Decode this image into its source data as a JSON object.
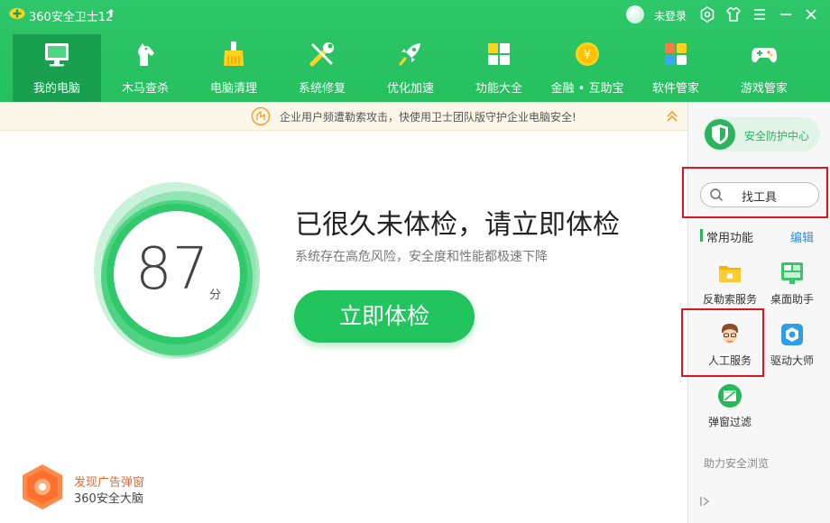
{
  "titlebar": {
    "app_title": "360安全卫士12",
    "login_label": "未登录"
  },
  "nav": {
    "items": [
      {
        "label": "我的电脑",
        "icon": "monitor-icon",
        "active": true
      },
      {
        "label": "木马查杀",
        "icon": "horse-icon",
        "active": false
      },
      {
        "label": "电脑清理",
        "icon": "broom-icon",
        "active": false
      },
      {
        "label": "系统修复",
        "icon": "wrench-icon",
        "active": false
      },
      {
        "label": "优化加速",
        "icon": "rocket-icon",
        "active": false
      },
      {
        "label": "功能大全",
        "icon": "apps-grid-icon",
        "active": false
      },
      {
        "label": "金融 • 互助宝",
        "icon": "yen-coin-icon",
        "active": false
      },
      {
        "label": "软件管家",
        "icon": "software-store-icon",
        "active": false
      },
      {
        "label": "游戏管家",
        "icon": "gamepad-icon",
        "active": false
      }
    ]
  },
  "notice": {
    "text": "企业用户频遭勒索攻击，快使用卫士团队版守护企业电脑安全!"
  },
  "main": {
    "score": "87",
    "score_unit": "分",
    "headline": "已很久未体检，请立即体检",
    "subline": "系统存在高危风险，安全度和性能都极速下降",
    "check_button": "立即体检"
  },
  "brain": {
    "title": "发现广告弹窗",
    "subtitle": "360安全大脑"
  },
  "sidebar": {
    "security_center": "安全防护中心",
    "search_label": "找工具",
    "common_title": "常用功能",
    "edit_label": "编辑",
    "tools": [
      {
        "label": "反勒索服务",
        "icon": "folder-lock-icon"
      },
      {
        "label": "桌面助手",
        "icon": "desktop-assistant-icon"
      },
      {
        "label": "人工服务",
        "icon": "support-person-icon"
      },
      {
        "label": "驱动大师",
        "icon": "driver-icon"
      },
      {
        "label": "弹窗过滤",
        "icon": "popup-filter-icon"
      }
    ],
    "more_label": "助力安全浏览"
  },
  "colors": {
    "brand_green": "#25c05e",
    "active_nav": "#19a04f",
    "highlight_red": "#e0141e",
    "link_blue": "#2a8de0",
    "warning_orange": "#e86a2a"
  }
}
